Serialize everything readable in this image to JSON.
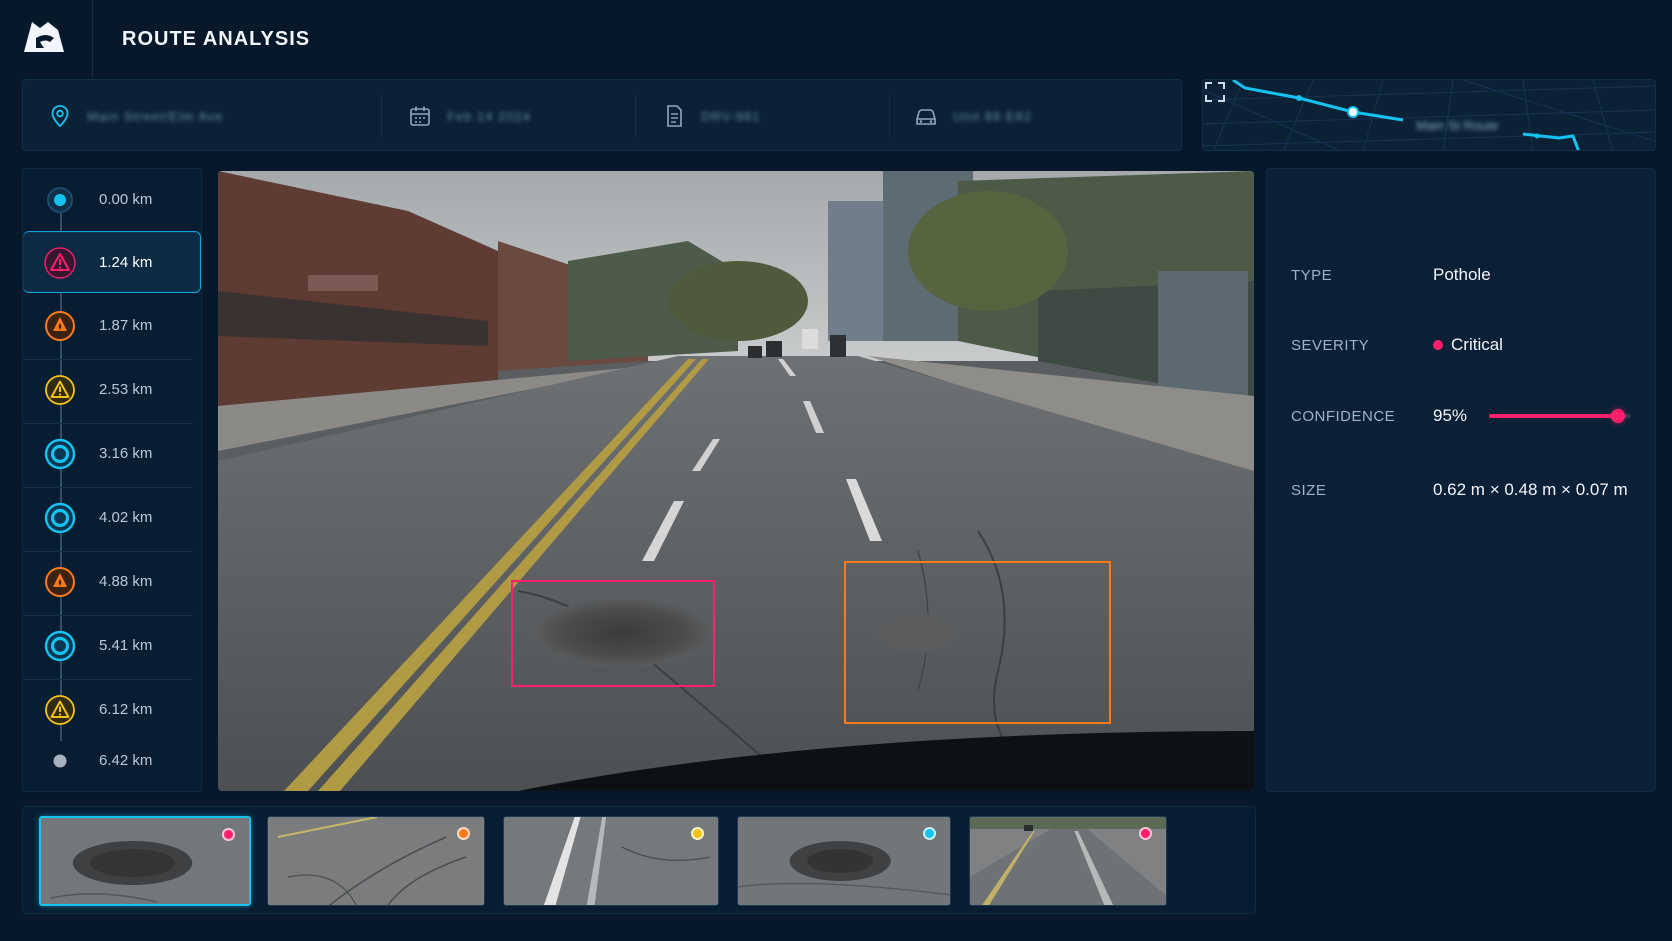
{
  "header": {
    "title": "ROUTE ANALYSIS"
  },
  "info_bar": {
    "location": "Main Street/Elm Ave",
    "date": "Feb 14 2024",
    "scan_id": "DRV-981",
    "vehicle": "Unit 88 E82"
  },
  "minimap": {
    "label": "Main St Route"
  },
  "timeline": {
    "items": [
      {
        "distance": "0.00 km",
        "kind": "start"
      },
      {
        "distance": "1.24 km",
        "kind": "critical"
      },
      {
        "distance": "1.87 km",
        "kind": "high"
      },
      {
        "distance": "2.53 km",
        "kind": "medium"
      },
      {
        "distance": "3.16 km",
        "kind": "low"
      },
      {
        "distance": "4.02 km",
        "kind": "low"
      },
      {
        "distance": "4.88 km",
        "kind": "high"
      },
      {
        "distance": "5.41 km",
        "kind": "low"
      },
      {
        "distance": "6.12 km",
        "kind": "medium"
      },
      {
        "distance": "6.42 km",
        "kind": "end"
      }
    ],
    "active_index": 1
  },
  "details": {
    "type_label": "TYPE",
    "type_value": "Pothole",
    "severity_label": "SEVERITY",
    "severity_value": "Critical",
    "confidence_label": "CONFIDENCE",
    "confidence_value": "95%",
    "confidence_fraction": 0.95,
    "size_label": "SIZE",
    "size_value": "0.62 m × 0.48 m × 0.07 m"
  },
  "colors": {
    "accent": "#16c3f0",
    "critical": "#ff1f6b",
    "high": "#ff7a1a",
    "medium": "#f2c21b",
    "low": "#16c3f0"
  },
  "thumbnails": [
    {
      "severity": "critical",
      "selected": true
    },
    {
      "severity": "high",
      "selected": false
    },
    {
      "severity": "medium",
      "selected": false
    },
    {
      "severity": "low",
      "selected": false
    },
    {
      "severity": "critical",
      "selected": false
    }
  ]
}
